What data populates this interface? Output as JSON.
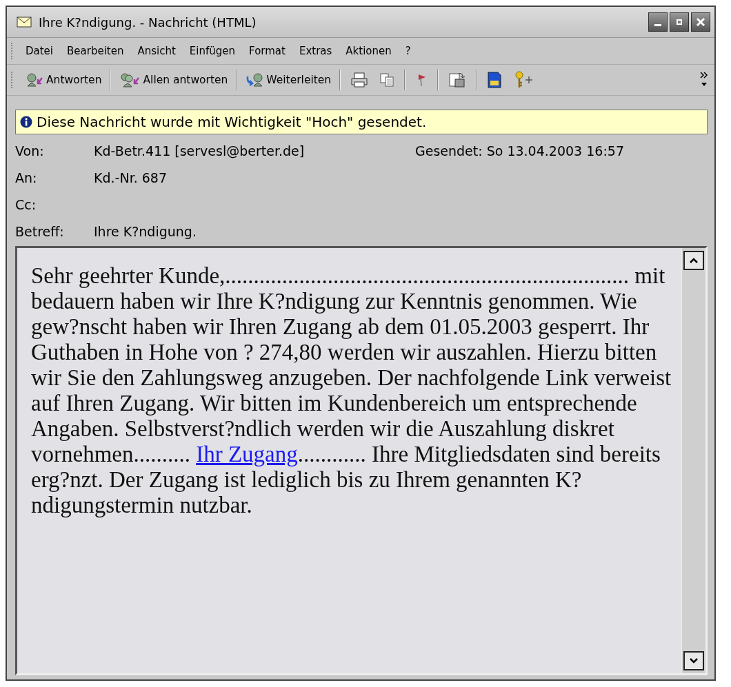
{
  "window": {
    "title": "Ihre K?ndigung. - Nachricht (HTML)"
  },
  "menu": [
    "Datei",
    "Bearbeiten",
    "Ansicht",
    "Einfügen",
    "Format",
    "Extras",
    "Aktionen",
    "?"
  ],
  "toolbar": [
    {
      "kind": "reply",
      "label": "Antworten"
    },
    {
      "kind": "reply-all",
      "label": "Allen antworten"
    },
    {
      "kind": "forward",
      "label": "Weiterleiten"
    },
    {
      "kind": "print"
    },
    {
      "kind": "copy"
    },
    {
      "kind": "flag"
    },
    {
      "kind": "move"
    },
    {
      "kind": "notes"
    },
    {
      "kind": "key"
    }
  ],
  "info_bar": "Diese Nachricht wurde mit Wichtigkeit \"Hoch\" gesendet.",
  "headers": [
    {
      "label": "Von:",
      "value": "Kd-Betr.411 [servesl@berter.de]",
      "extra": "Gesendet: So 13.04.2003 16:57"
    },
    {
      "label": "An:",
      "value": "Kd.-Nr. 687"
    },
    {
      "label": "Cc:"
    },
    {
      "label": "Betreff:",
      "value": "Ihre K?ndigung."
    }
  ],
  "body": {
    "before": "Sehr geehrter Kunde,....................................................................... mit bedauern haben wir Ihre K?ndigung zur Kenntnis genommen. Wie gew?nscht haben wir Ihren Zugang ab dem 01.05.2003 gesperrt. Ihr Guthaben in Hohe von ? 274,80 werden wir auszahlen. Hierzu bitten wir Sie den Zahlungsweg anzugeben. Der nachfolgende Link verweist auf Ihren Zugang. Wir bitten im Kundenbereich um entsprechende Angaben. Selbstverst?ndlich werden wir die Auszahlung diskret vornehmen.......... ",
    "link": "Ihr Zugang",
    "after": "............ Ihre Mitgliedsdaten sind bereits erg?nzt. Der Zugang ist lediglich bis zu Ihrem genannten K?ndigungstermin nutzbar."
  }
}
